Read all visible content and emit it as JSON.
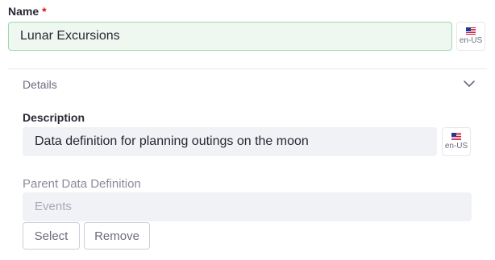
{
  "name_field": {
    "label": "Name",
    "required_mark": "*",
    "value": "Lunar Excursions",
    "locale": "en-US"
  },
  "details": {
    "title": "Details",
    "toggle_icon": "chevron-down-icon"
  },
  "description_field": {
    "label": "Description",
    "value": "Data definition for planning outings on the moon",
    "locale": "en-US"
  },
  "parent_field": {
    "label": "Parent Data Definition",
    "placeholder": "Events",
    "select_label": "Select",
    "remove_label": "Remove"
  },
  "colors": {
    "success_bg": "#eef8f1",
    "success_border": "#9dd9ad",
    "required": "#da1414",
    "input_bg": "#f1f2f5"
  }
}
